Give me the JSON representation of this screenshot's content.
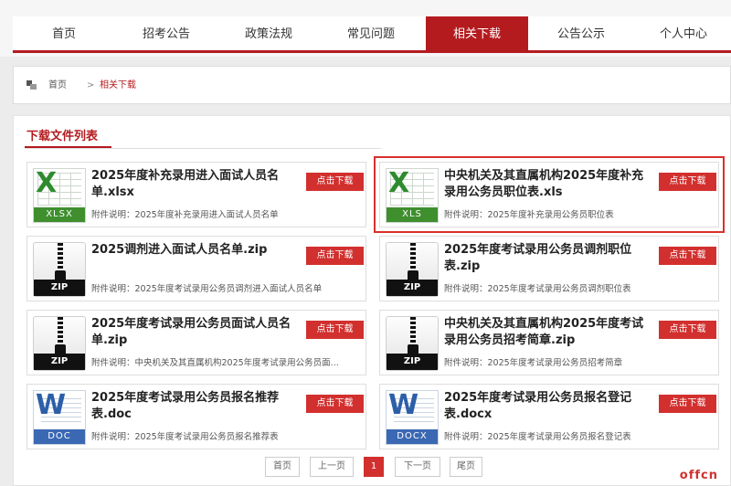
{
  "nav": {
    "tabs": [
      "首页",
      "招考公告",
      "政策法规",
      "常见问题",
      "相关下载",
      "公告公示",
      "个人中心"
    ],
    "active": "相关下载"
  },
  "breadcrumb": {
    "home": "首页",
    "sep": ">",
    "current": "相关下载"
  },
  "section_title": "下载文件列表",
  "download_label": "点击下载",
  "files": [
    {
      "name": "2025年度补充录用进入面试人员名单.xlsx",
      "desc": "附件说明：2025年度补充录用进入面试人员名单",
      "type": "XLSX",
      "icon": "excel-icon"
    },
    {
      "name": "中央机关及其直属机构2025年度补充录用公务员职位表.xls",
      "desc": "附件说明：2025年度补充录用公务员职位表",
      "type": "XLS",
      "icon": "excel-icon"
    },
    {
      "name": "2025调剂进入面试人员名单.zip",
      "desc": "附件说明：2025年度考试录用公务员调剂进入面试人员名单",
      "type": "ZIP",
      "icon": "zip-icon"
    },
    {
      "name": "2025年度考试录用公务员调剂职位表.zip",
      "desc": "附件说明：2025年度考试录用公务员调剂职位表",
      "type": "ZIP",
      "icon": "zip-icon"
    },
    {
      "name": "2025年度考试录用公务员面试人员名单.zip",
      "desc": "附件说明：中央机关及其直属机构2025年度考试录用公务员面...",
      "type": "ZIP",
      "icon": "zip-icon"
    },
    {
      "name": "中央机关及其直属机构2025年度考试录用公务员招考简章.zip",
      "desc": "附件说明：2025年度考试录用公务员招考简章",
      "type": "ZIP",
      "icon": "zip-icon"
    },
    {
      "name": "2025年度考试录用公务员报名推荐表.doc",
      "desc": "附件说明：2025年度考试录用公务员报名推荐表",
      "type": "DOC",
      "icon": "word-icon"
    },
    {
      "name": "2025年度考试录用公务员报名登记表.docx",
      "desc": "附件说明：2025年度考试录用公务员报名登记表",
      "type": "DOCX",
      "icon": "word-icon"
    }
  ],
  "pager": {
    "first": "首页",
    "prev": "上一页",
    "current": "1",
    "next": "下一页",
    "last": "尾页"
  },
  "watermark": "offcn",
  "colors": {
    "brand": "#b41b1f",
    "button": "#d2302e",
    "excel": "#3f8f2f",
    "word": "#3a68b3"
  }
}
